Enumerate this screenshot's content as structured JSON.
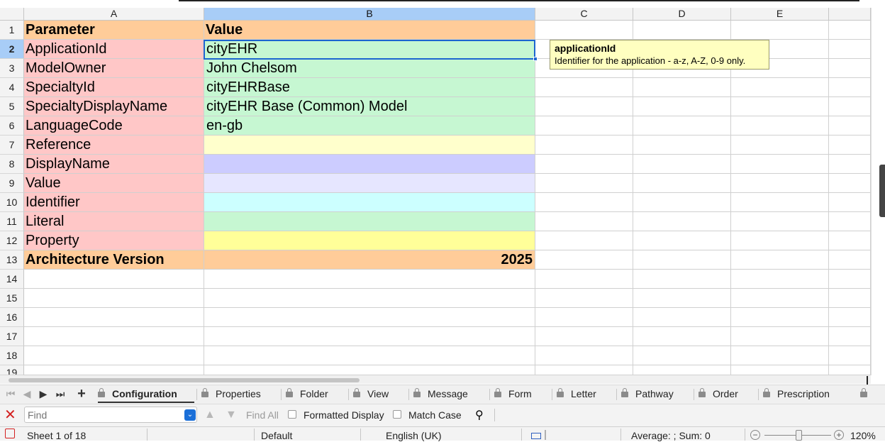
{
  "columns": [
    "A",
    "B",
    "C",
    "D",
    "E"
  ],
  "rows": [
    "1",
    "2",
    "3",
    "4",
    "5",
    "6",
    "7",
    "8",
    "9",
    "10",
    "11",
    "12",
    "13",
    "14",
    "15",
    "16",
    "17",
    "18",
    "19"
  ],
  "table": [
    {
      "a": "Parameter",
      "b": "Value",
      "a_color": "#ffcc99",
      "b_color": "#ffcc99",
      "bold": true
    },
    {
      "a": "ApplicationId",
      "b": "cityEHR",
      "a_color": "#ffc7c7",
      "b_color": "#c6f7d2"
    },
    {
      "a": "ModelOwner",
      "b": "John Chelsom",
      "a_color": "#ffc7c7",
      "b_color": "#c6f7d2"
    },
    {
      "a": "SpecialtyId",
      "b": "cityEHRBase",
      "a_color": "#ffc7c7",
      "b_color": "#c6f7d2"
    },
    {
      "a": "SpecialtyDisplayName",
      "b": "cityEHR Base (Common) Model",
      "a_color": "#ffc7c7",
      "b_color": "#c6f7d2"
    },
    {
      "a": "LanguageCode",
      "b": "en-gb",
      "a_color": "#ffc7c7",
      "b_color": "#c6f7d2"
    },
    {
      "a": "Reference",
      "b": "",
      "a_color": "#ffc7c7",
      "b_color": "#ffffcc"
    },
    {
      "a": "DisplayName",
      "b": "",
      "a_color": "#ffc7c7",
      "b_color": "#ccccff"
    },
    {
      "a": "Value",
      "b": "",
      "a_color": "#ffc7c7",
      "b_color": "#e6e6ff"
    },
    {
      "a": "Identifier",
      "b": "",
      "a_color": "#ffc7c7",
      "b_color": "#ccffff"
    },
    {
      "a": "Literal",
      "b": "",
      "a_color": "#ffc7c7",
      "b_color": "#c6f7d2"
    },
    {
      "a": "Property",
      "b": "",
      "a_color": "#ffc7c7",
      "b_color": "#ffff99"
    },
    {
      "a": "Architecture Version",
      "b": "2025",
      "a_color": "#ffcc99",
      "b_color": "#ffcc99",
      "bold": true,
      "b_right": true
    }
  ],
  "comment": {
    "title": "applicationId",
    "text": "Identifier for the application - a-z, A-Z, 0-9 only."
  },
  "sheet_tabs": [
    "Configuration",
    "Properties",
    "Folder",
    "View",
    "Message",
    "Form",
    "Letter",
    "Pathway",
    "Order",
    "Prescription"
  ],
  "active_tab": "Configuration",
  "find": {
    "placeholder": "Find",
    "find_all": "Find All",
    "formatted_display": "Formatted Display",
    "match_case": "Match Case"
  },
  "status": {
    "sheet": "Sheet 1 of 18",
    "style": "Default",
    "language": "English (UK)",
    "summary": "Average: ; Sum: 0",
    "zoom": "120%"
  },
  "colors": {
    "selection_border": "#1d66d0",
    "header_selected": "#a8cdf7",
    "comment_bg": "#ffffc0"
  }
}
